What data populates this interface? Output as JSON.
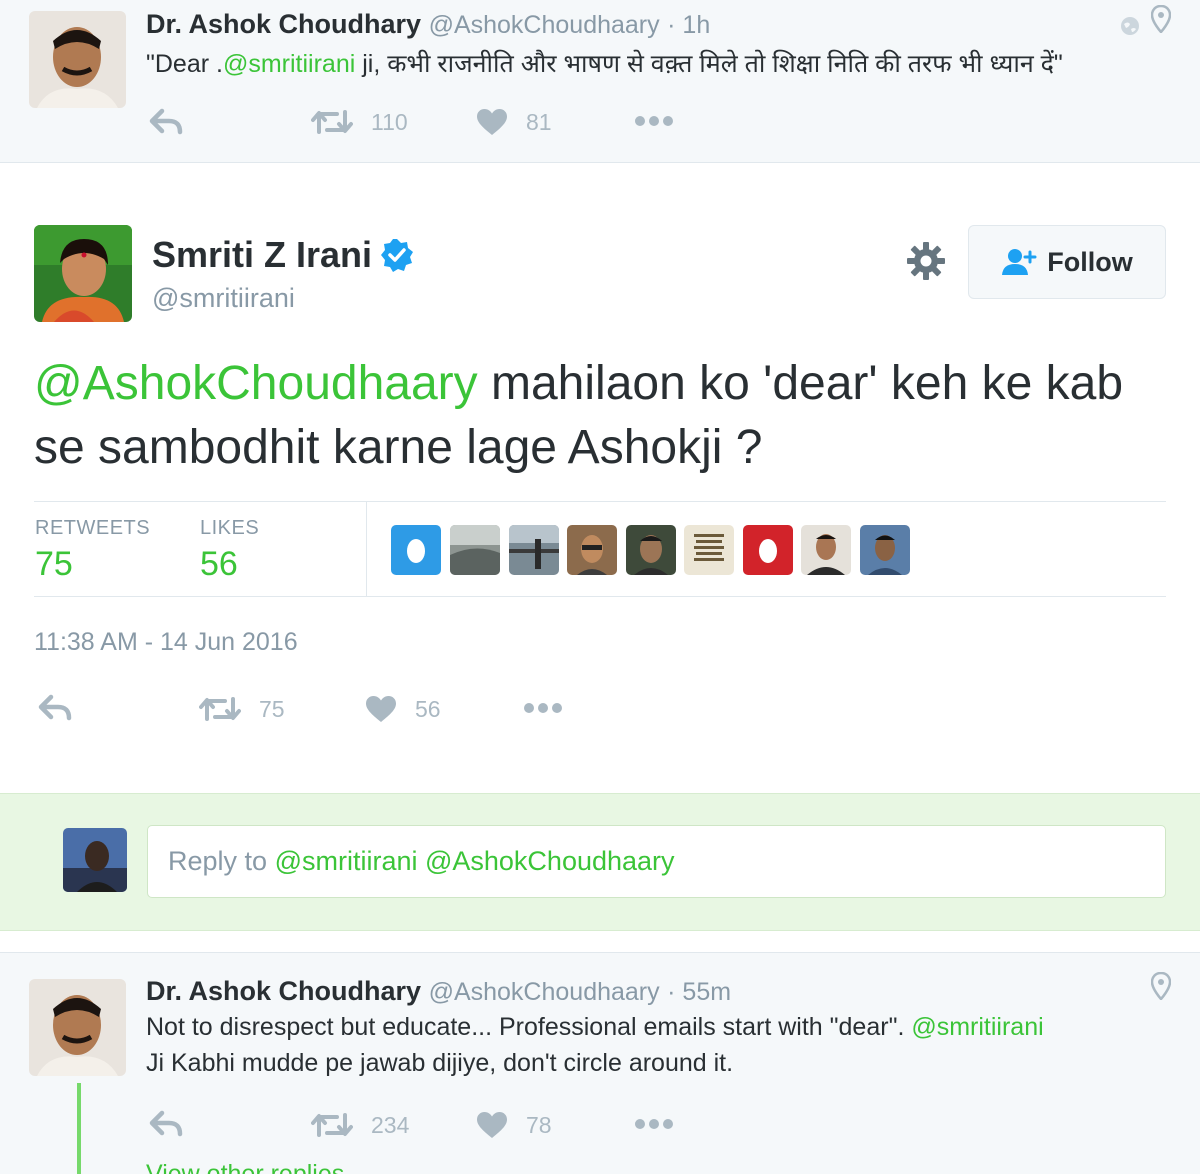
{
  "top_tweet": {
    "name": "Dr. Ashok Choudhary",
    "handle": "@AshokChoudhaary",
    "time": "· 1h",
    "text_pre": "\"Dear .",
    "mention": "@smritiirani",
    "text_post": " ji, कभी राजनीति और भाषण से वक़्त मिले तो शिक्षा निति की तरफ भी ध्यान दें\"",
    "retweets": "110",
    "likes": "81",
    "icons": [
      "reply-icon",
      "retweet-icon",
      "heart-icon",
      "more-icon",
      "globe-icon",
      "location-pin-icon"
    ]
  },
  "main_tweet": {
    "name": "Smriti Z Irani",
    "handle": "@smritiirani",
    "follow_label": "Follow",
    "mention": "@AshokChoudhaary",
    "text": " mahilaon ko 'dear' keh ke kab se sambodhit karne lage Ashokji ?",
    "stats": {
      "retweets_label": "RETWEETS",
      "retweets": "75",
      "likes_label": "LIKES",
      "likes": "56"
    },
    "liker_count": 9,
    "timestamp": "11:38 AM - 14 Jun 2016",
    "retweets": "75",
    "likes": "56",
    "icons": [
      "verified-badge-icon",
      "gear-icon",
      "follow-user-icon",
      "reply-icon",
      "retweet-icon",
      "heart-icon",
      "more-icon"
    ]
  },
  "reply_box": {
    "prefix": "Reply to ",
    "mentions": "@smritiirani @AshokChoudhaary"
  },
  "bottom_tweet": {
    "name": "Dr. Ashok Choudhary",
    "handle": "@AshokChoudhaary",
    "time": "· 55m",
    "line1_text": "Not to disrespect but educate... Professional emails start with \"dear\". ",
    "line1_mention": "@smritiirani",
    "line2": "Ji Kabhi mudde pe jawab dijiye, don't circle around it.",
    "retweets": "234",
    "likes": "78",
    "view_more": "View other replies",
    "icons": [
      "reply-icon",
      "retweet-icon",
      "heart-icon",
      "more-icon",
      "location-pin-icon"
    ]
  },
  "colors": {
    "accent": "#3bc438",
    "muted": "#8899a6",
    "text": "#292f33",
    "icon": "#aab8c2",
    "verified": "#1da1f2",
    "reply_area": "#e8f7e3"
  }
}
